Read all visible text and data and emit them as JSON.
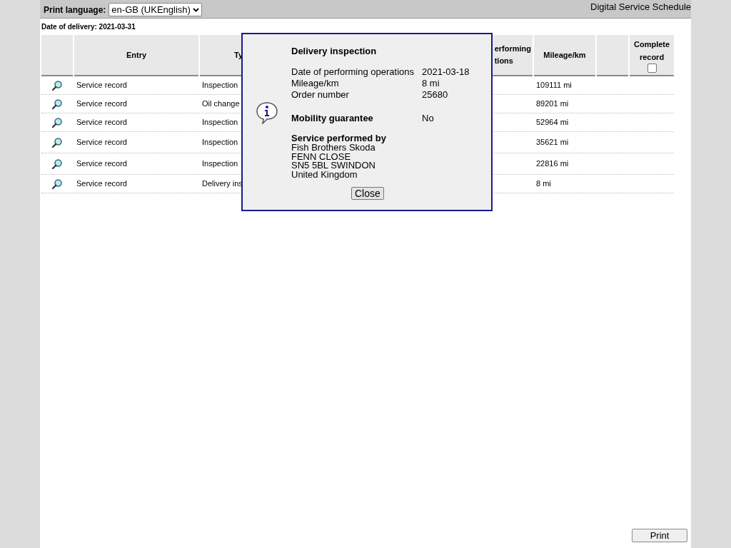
{
  "header": {
    "language_label": "Print language:",
    "language_value": "en-GB (UKEnglish)",
    "app_title": "Digital Service Schedule"
  },
  "delivery_date": "Date of delivery: 2021-03-31",
  "table": {
    "columns": {
      "entry": "Entry",
      "type": "Ty",
      "date": [
        "erforming",
        "tions"
      ],
      "mileage": "Mileage/km",
      "complete": {
        "label": "Complete record",
        "checked": false
      }
    },
    "rows": [
      {
        "entry": "Service record",
        "type": "Inspection",
        "mileage": "109111 mi"
      },
      {
        "entry": "Service record",
        "type": "Oil change",
        "mileage": "89201 mi"
      },
      {
        "entry": "Service record",
        "type": "Inspection",
        "mileage": "52964 mi"
      },
      {
        "entry": "Service record",
        "type": "Inspection",
        "mileage": "35621 mi"
      },
      {
        "entry": "Service record",
        "type": "Inspection",
        "mileage": "22816 mi"
      },
      {
        "entry": "Service record",
        "type": "Delivery ins",
        "mileage": "8 mi"
      }
    ]
  },
  "dialog": {
    "title": "Delivery inspection",
    "fields": [
      {
        "label": "Date of performing operations",
        "value": "2021-03-18"
      },
      {
        "label": "Mileage/km",
        "value": "8 mi"
      },
      {
        "label": "Order number",
        "value": "25680"
      }
    ],
    "mobility": {
      "label": "Mobility guarantee",
      "value": "No"
    },
    "service": {
      "heading": "Service performed by",
      "lines": [
        "Fish Brothers Skoda",
        "FENN CLOSE",
        "SN5 5BL SWINDON",
        "United Kingdom"
      ]
    },
    "close": "Close"
  },
  "print": "Print"
}
